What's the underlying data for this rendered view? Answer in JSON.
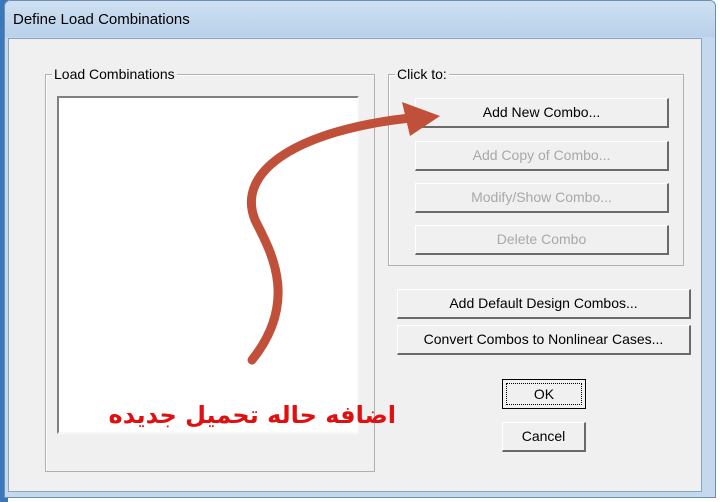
{
  "window": {
    "title": "Define Load Combinations"
  },
  "load_combinations": {
    "label": "Load Combinations",
    "items": []
  },
  "click_to": {
    "label": "Click to:",
    "add_new": "Add New Combo...",
    "add_copy": "Add Copy of Combo...",
    "modify_show": "Modify/Show Combo...",
    "delete": "Delete Combo"
  },
  "actions": {
    "add_default_design": "Add Default Design Combos...",
    "convert_nonlinear": "Convert Combos to Nonlinear Cases...",
    "ok": "OK",
    "cancel": "Cancel"
  },
  "annotation": {
    "text": "اضافه حاله تحميل جديده",
    "color": "#e01010",
    "arrow_color": "#c0503a"
  }
}
